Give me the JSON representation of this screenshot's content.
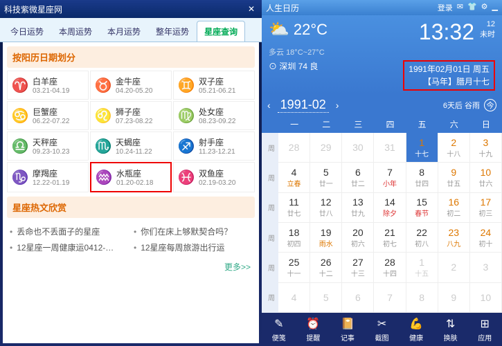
{
  "left": {
    "title": "科技紫微星座网",
    "tabs": [
      "今日运势",
      "本周运势",
      "本月运势",
      "整年运势",
      "星座查询"
    ],
    "activeTab": 4,
    "sec1": "按阳历日期划分",
    "zodiac": [
      {
        "sym": "♈",
        "name": "白羊座",
        "date": "03.21-04.19"
      },
      {
        "sym": "♉",
        "name": "金牛座",
        "date": "04.20-05.20"
      },
      {
        "sym": "♊",
        "name": "双子座",
        "date": "05.21-06.21"
      },
      {
        "sym": "♋",
        "name": "巨蟹座",
        "date": "06.22-07.22"
      },
      {
        "sym": "♌",
        "name": "狮子座",
        "date": "07.23-08.22"
      },
      {
        "sym": "♍",
        "name": "处女座",
        "date": "08.23-09.22"
      },
      {
        "sym": "♎",
        "name": "天秤座",
        "date": "09.23-10.23"
      },
      {
        "sym": "♏",
        "name": "天蝎座",
        "date": "10.24-11.22"
      },
      {
        "sym": "♐",
        "name": "射手座",
        "date": "11.23-12.21"
      },
      {
        "sym": "♑",
        "name": "摩羯座",
        "date": "12.22-01.19"
      },
      {
        "sym": "♒",
        "name": "水瓶座",
        "date": "01.20-02.18"
      },
      {
        "sym": "♓",
        "name": "双鱼座",
        "date": "02.19-03.20"
      }
    ],
    "highlight": 10,
    "sec2": "星座热文欣赏",
    "articles": [
      [
        "丢命也不丢面子的星座",
        "你们在床上够默契合吗？"
      ],
      [
        "12星座一周健康运0412-…",
        "12星座每周旅游出行运"
      ]
    ],
    "more": "更多>>"
  },
  "right": {
    "title": "人生日历",
    "login": "登录",
    "weatherIcon": "⛅",
    "temp": "22°C",
    "cond": "多云",
    "range": "18°C~27°C",
    "time": "13:32",
    "timeSide": {
      "top": "12",
      "bot": "未时"
    },
    "loc": "深圳 74 良",
    "dateLine1": "1991年02月01日 周五",
    "dateLine2": "【马年】腊月十七",
    "month": "1991-02",
    "nextTerm": "6天后 谷雨",
    "today": "今",
    "wh": [
      "一",
      "二",
      "三",
      "四",
      "五",
      "六",
      "日"
    ],
    "weeks": [
      "周",
      "周",
      "周",
      "周",
      "周",
      "周"
    ],
    "cells": [
      {
        "d": "28",
        "l": "",
        "dim": 1
      },
      {
        "d": "29",
        "l": "",
        "dim": 1
      },
      {
        "d": "30",
        "l": "",
        "dim": 1
      },
      {
        "d": "31",
        "l": "",
        "dim": 1
      },
      {
        "d": "1",
        "l": "十七",
        "sel": 1,
        "we": 1
      },
      {
        "d": "2",
        "l": "十八",
        "we": 1
      },
      {
        "d": "3",
        "l": "十九",
        "we": 1
      },
      {
        "d": "4",
        "l": "立春",
        "t": 1
      },
      {
        "d": "5",
        "l": "廿一"
      },
      {
        "d": "6",
        "l": "廿二"
      },
      {
        "d": "7",
        "l": "小年",
        "f": 1
      },
      {
        "d": "8",
        "l": "廿四"
      },
      {
        "d": "9",
        "l": "廿五",
        "we": 1
      },
      {
        "d": "10",
        "l": "廿六",
        "we": 1
      },
      {
        "d": "11",
        "l": "廿七"
      },
      {
        "d": "12",
        "l": "廿八"
      },
      {
        "d": "13",
        "l": "廿九"
      },
      {
        "d": "14",
        "l": "除夕",
        "f": 1
      },
      {
        "d": "15",
        "l": "春节",
        "f": 1
      },
      {
        "d": "16",
        "l": "初二",
        "we": 1
      },
      {
        "d": "17",
        "l": "初三",
        "we": 1
      },
      {
        "d": "18",
        "l": "初四"
      },
      {
        "d": "19",
        "l": "雨水",
        "t": 1
      },
      {
        "d": "20",
        "l": "初六"
      },
      {
        "d": "21",
        "l": "初七"
      },
      {
        "d": "22",
        "l": "初八"
      },
      {
        "d": "23",
        "l": "八九",
        "we": 1,
        "t": 1
      },
      {
        "d": "24",
        "l": "初十",
        "we": 1
      },
      {
        "d": "25",
        "l": "十一"
      },
      {
        "d": "26",
        "l": "十二"
      },
      {
        "d": "27",
        "l": "十三"
      },
      {
        "d": "28",
        "l": "十四"
      },
      {
        "d": "1",
        "l": "十五",
        "dim": 1
      },
      {
        "d": "2",
        "l": "",
        "dim": 1
      },
      {
        "d": "3",
        "l": "",
        "dim": 1
      },
      {
        "d": "4",
        "l": "",
        "dim": 1
      },
      {
        "d": "5",
        "l": "",
        "dim": 1
      },
      {
        "d": "6",
        "l": "",
        "dim": 1
      },
      {
        "d": "7",
        "l": "",
        "dim": 1
      },
      {
        "d": "8",
        "l": "",
        "dim": 1
      },
      {
        "d": "9",
        "l": "",
        "dim": 1
      },
      {
        "d": "10",
        "l": "",
        "dim": 1
      }
    ],
    "bbar": [
      {
        "i": "✎",
        "t": "便笺"
      },
      {
        "i": "⏰",
        "t": "提醒"
      },
      {
        "i": "📔",
        "t": "记事"
      },
      {
        "i": "✂",
        "t": "截图"
      },
      {
        "i": "💪",
        "t": "健康"
      },
      {
        "i": "⇅",
        "t": "换肤"
      },
      {
        "i": "⊞",
        "t": "应用"
      }
    ]
  }
}
